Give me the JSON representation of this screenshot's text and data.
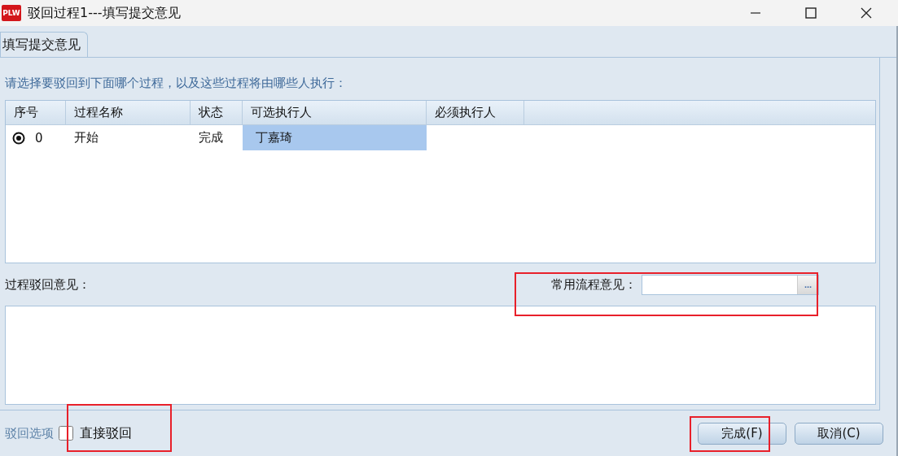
{
  "window": {
    "app_icon": "PLW",
    "title": "驳回过程1---填写提交意见"
  },
  "tabs": [
    {
      "label": "填写提交意见",
      "selected": true
    }
  ],
  "instruction": "请选择要驳回到下面哪个过程，以及这些过程将由哪些人执行：",
  "table": {
    "columns": [
      "序号",
      "过程名称",
      "状态",
      "可选执行人",
      "必须执行人"
    ],
    "rows": [
      {
        "selected": true,
        "index": "0",
        "name": "开始",
        "status": "完成",
        "optional_executor": "丁嘉琦"
      }
    ]
  },
  "opinion": {
    "label": "过程驳回意见：",
    "common_label": "常用流程意见：",
    "browse_button": "..."
  },
  "options": {
    "label": "驳回选项",
    "direct_reject": {
      "label": "直接驳回",
      "checked": false
    }
  },
  "buttons": [
    {
      "label": "完成(F)"
    },
    {
      "label": "取消(C)"
    }
  ]
}
